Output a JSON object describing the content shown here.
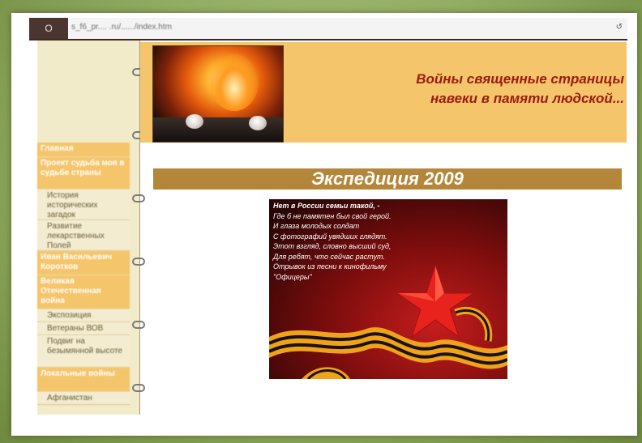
{
  "browser": {
    "url": "s_f6_pr.... .ru/....../index.htm",
    "nav_button": "O",
    "dropdown": "↺"
  },
  "sidebar": {
    "items": [
      {
        "label": "Главная",
        "type": "main"
      },
      {
        "label": "Проект судьба моя в судьбе страны",
        "type": "main"
      },
      {
        "label": "История исторических загадок",
        "type": "sub"
      },
      {
        "label": "Развитие лекарственных Полей",
        "type": "sub"
      },
      {
        "label": "Иван Васильевич Коротков",
        "type": "main"
      },
      {
        "label": "Великая Отечественная война",
        "type": "main"
      },
      {
        "label": "Экспозиция",
        "type": "sub"
      },
      {
        "label": "Ветераны ВОВ",
        "type": "sub"
      },
      {
        "label": "Подвиг на безымянной высоте",
        "type": "sub"
      },
      {
        "label": "Локальные войны",
        "type": "main"
      },
      {
        "label": "Афганистан",
        "type": "sub"
      }
    ]
  },
  "header": {
    "title_line1": "Войны священные страницы",
    "title_line2": "навеки в памяти людской..."
  },
  "banner": {
    "title": "Экспедиция 2009"
  },
  "poster": {
    "lines": [
      "Нет в России семьи такой, -",
      "Где б не памятен был свой герой.",
      "И глаза молодых солдат",
      "С фотографий увядших глядят.",
      "Этот взгляд, словно высший суд,",
      "Для ребят, что сейчас растут.",
      "Отрывок из песни к кинофильму",
      "\"Офицеры\""
    ]
  },
  "colors": {
    "header_bg": "#f5c56b",
    "banner_bg": "#b48639",
    "title_red": "#9b1c12",
    "sidebar_bg": "#f2ebc9"
  }
}
